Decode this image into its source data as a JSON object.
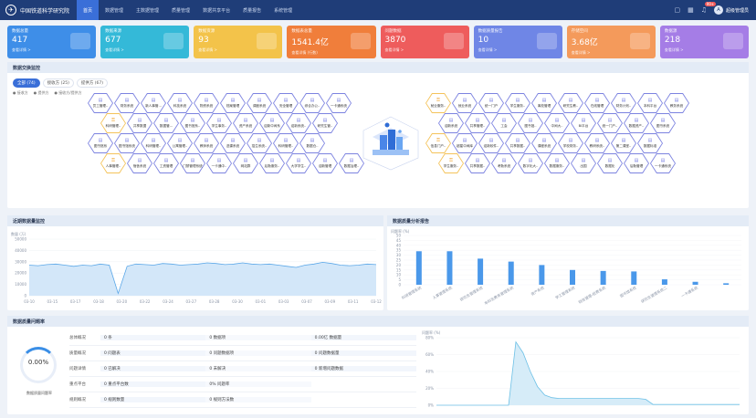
{
  "app": {
    "title": "中国铁道科学研究院",
    "nav": [
      "首页",
      "数据管理",
      "主数据管理",
      "质量管理",
      "数据共享平台",
      "质量报告",
      "系统管理"
    ],
    "active_nav": 0,
    "right_icons": [
      "monitor-icon",
      "grid-icon",
      "bell-icon"
    ],
    "notification_count": "99+",
    "user": "超级管理员"
  },
  "cards": [
    {
      "title": "数据总量",
      "value": "417",
      "link": "查看详情 >",
      "color": "#3e8ee8"
    },
    {
      "title": "数据来源",
      "value": "677",
      "link": "查看详情 >",
      "color": "#34b9d8"
    },
    {
      "title": "数据资源",
      "value": "93",
      "link": "查看详情 >",
      "color": "#f3c34a"
    },
    {
      "title": "数据表总量",
      "value": "1541.4亿",
      "link": "查看详情 (行数)",
      "color": "#f07e3b"
    },
    {
      "title": "问题数据",
      "value": "3870",
      "link": "查看详情 >",
      "color": "#ee5c5c"
    },
    {
      "title": "数据质量报告",
      "value": "10",
      "link": "查看详情 >",
      "color": "#6f86e6"
    },
    {
      "title": "存储空间",
      "value": "3.68亿",
      "link": "查看详情 >",
      "color": "#f49a5b"
    },
    {
      "title": "数据源",
      "value": "218",
      "link": "查看详情 >",
      "color": "#a57de6"
    }
  ],
  "topology": {
    "title": "数据交换监控",
    "filters": [
      {
        "label": "全部 (74)"
      },
      {
        "label": "接收方 (25)"
      },
      {
        "label": "提供方 (67)"
      }
    ],
    "legend": [
      "● 接收方",
      "● 提供方",
      "● 接收方/提供方"
    ],
    "left_hexes": [
      {
        "n": "员工管理..",
        "s": "on"
      },
      {
        "n": "财务系统",
        "s": "on"
      },
      {
        "n": "新人事管...",
        "s": "on"
      },
      {
        "n": "科技系统",
        "s": "on"
      },
      {
        "n": "物资系统",
        "s": "on"
      },
      {
        "n": "档案管理",
        "s": "on"
      },
      {
        "n": "调度系统",
        "s": "on"
      },
      {
        "n": "安全管理",
        "s": "on"
      },
      {
        "n": "综合办公..",
        "s": "on"
      },
      {
        "n": "一卡通系统",
        "s": "on"
      },
      {
        "n": "科研管理..",
        "s": "warn"
      },
      {
        "n": "共享数据",
        "s": "on"
      },
      {
        "n": "数据管...",
        "s": "on"
      },
      {
        "n": "图书馆系..",
        "s": "on"
      },
      {
        "n": "学生事务..",
        "s": "on"
      },
      {
        "n": "资产系统",
        "s": "on"
      },
      {
        "n": "迎新中间系",
        "s": "on"
      },
      {
        "n": "迎新系统..",
        "s": "on"
      },
      {
        "n": "研究生管..",
        "s": "on"
      },
      {
        "n": "图书馆系",
        "s": "on"
      },
      {
        "n": "图书馆系统",
        "s": "on"
      },
      {
        "n": "科研管理..",
        "s": "on"
      },
      {
        "n": "公寓管理..",
        "s": "on"
      },
      {
        "n": "教师系统",
        "s": "on"
      },
      {
        "n": "选课系统",
        "s": "on"
      },
      {
        "n": "招生系统..",
        "s": "on"
      },
      {
        "n": "科研管理..",
        "s": "on"
      },
      {
        "n": "数据仓..",
        "s": "on"
      },
      {
        "n": "人事管理..",
        "s": "warn"
      },
      {
        "n": "宿舍系统",
        "s": "on"
      },
      {
        "n": "工资管理",
        "s": "on"
      },
      {
        "n": "门禁管理系统",
        "s": "on"
      },
      {
        "n": "一卡通中..",
        "s": "on"
      },
      {
        "n": "网站群",
        "s": "on"
      },
      {
        "n": "后勤服务..",
        "s": "on"
      },
      {
        "n": "大学学生..",
        "s": "on"
      },
      {
        "n": "迎新管理",
        "s": "on"
      },
      {
        "n": "数据治理..",
        "s": "on"
      }
    ],
    "right_hexes": [
      {
        "n": "就业服务..",
        "s": "warn"
      },
      {
        "n": "就业系统",
        "s": "on"
      },
      {
        "n": "统一门户",
        "s": "on"
      },
      {
        "n": "学生服务..",
        "s": "on"
      },
      {
        "n": "离校管理",
        "s": "on"
      },
      {
        "n": "研究生教..",
        "s": "on"
      },
      {
        "n": "在线管理",
        "s": "on"
      },
      {
        "n": "财务计划..",
        "s": "on"
      },
      {
        "n": "本科平台",
        "s": "on"
      },
      {
        "n": "教务系统",
        "s": "on"
      },
      {
        "n": "迎新系统",
        "s": "on"
      },
      {
        "n": "共享管理..",
        "s": "on"
      },
      {
        "n": "工会",
        "s": "on"
      },
      {
        "n": "图书馆..",
        "s": "on"
      },
      {
        "n": "中间大..",
        "s": "on"
      },
      {
        "n": "BI平台",
        "s": "on"
      },
      {
        "n": "统一门户..",
        "s": "on"
      },
      {
        "n": "数据资产..",
        "s": "on"
      },
      {
        "n": "图书系统",
        "s": "on"
      },
      {
        "n": "信息门户..",
        "s": "warn"
      },
      {
        "n": "超星中间库",
        "s": "on"
      },
      {
        "n": "迎新软件..",
        "s": "on"
      },
      {
        "n": "共享数据..",
        "s": "on"
      },
      {
        "n": "课程系统",
        "s": "on"
      },
      {
        "n": "学校财务..",
        "s": "on"
      },
      {
        "n": "教研系统..",
        "s": "on"
      },
      {
        "n": "第二课堂..",
        "s": "on"
      },
      {
        "n": "数据标准",
        "s": "on"
      },
      {
        "n": "学生服务..",
        "s": "warn"
      },
      {
        "n": "共享数据..",
        "s": "on"
      },
      {
        "n": "考勤系统",
        "s": "on"
      },
      {
        "n": "数字化大..",
        "s": "on"
      },
      {
        "n": "数据服务..",
        "s": "on"
      },
      {
        "n": "出国",
        "s": "on"
      },
      {
        "n": "数据化",
        "s": "on"
      },
      {
        "n": "后勤管理",
        "s": "on"
      },
      {
        "n": "一卡通系统",
        "s": "on"
      }
    ]
  },
  "line_panel": {
    "title": "近期数据量监控",
    "chart_data": {
      "type": "area",
      "ylabel": "数量 (万)",
      "yticks": [
        "50000",
        "40000",
        "30000",
        "20000",
        "10000",
        "0"
      ],
      "ylim": [
        0,
        50000
      ],
      "x": [
        "03-10",
        "03-15",
        "03-17",
        "03-18",
        "03-20",
        "03-22",
        "03-24",
        "03-27",
        "03-28",
        "03-30",
        "03-01",
        "03-03",
        "03-07",
        "03-09",
        "03-11",
        "03-12"
      ],
      "values": [
        27000,
        26500,
        27500,
        28000,
        27000,
        26000,
        27000,
        26500,
        28000,
        27000,
        2000,
        26000,
        28000,
        27500,
        27000,
        28500,
        28000,
        27000,
        27500,
        28000,
        29000,
        28500,
        27500,
        28000,
        29000,
        28000,
        27500,
        28000,
        27000,
        26000,
        25000,
        27000,
        28000,
        29500,
        28500,
        27000,
        26500,
        27000,
        28000,
        27500
      ]
    }
  },
  "bar_panel": {
    "title": "数据质量分析报告",
    "chart_data": {
      "type": "bar",
      "ylabel": "问题率 (%)",
      "yticks": [
        "50",
        "45",
        "40",
        "35",
        "30",
        "25",
        "20",
        "15",
        "10",
        "5",
        "0"
      ],
      "ylim": [
        0,
        50
      ],
      "categories": [
        "科研管理系统",
        "人事管理系统",
        "研究生管理系统",
        "本科生教务管理系统",
        "资产系统",
        "学工管理系统",
        "财务管理-经费系统",
        "图书馆系统",
        "研究生管理系统二",
        "一卡通系统"
      ],
      "values": [
        34,
        34,
        26.5,
        23.5,
        20,
        15,
        14,
        13.5,
        5.5,
        3,
        1.5
      ]
    }
  },
  "quality_panel": {
    "title": "数据质量问题率",
    "rate": "0.00%",
    "rate_caption": "数据质量问题率",
    "rows": [
      {
        "h": "总体概况",
        "c1": "0 条",
        "c2": "0 数据项",
        "c3": "0.00亿 数据量"
      },
      {
        "h": "质量概况",
        "c1": "0 问题表",
        "c2": "0 问题数据项",
        "c3": "0 问题数据量"
      },
      {
        "h": "问题详情",
        "c1": "0 已解决",
        "c2": "0 未解决",
        "c3": "0 新增问题数据"
      },
      {
        "h": "重点平台",
        "c1": "0 重点平台数",
        "c2": "0% 问题率",
        "c3": ""
      },
      {
        "h": "规则概况",
        "c1": "0 规则数量",
        "c2": "0 规则方法数",
        "c3": ""
      }
    ],
    "chart_data": {
      "type": "area",
      "ylabel": "问题率 (%)",
      "yticks": [
        "80%",
        "60%",
        "40%",
        "20%",
        "0%"
      ],
      "ylim": [
        0,
        80
      ],
      "values": [
        0,
        0,
        0,
        0,
        0,
        0,
        0,
        0,
        0,
        0,
        0,
        75,
        62,
        40,
        22,
        12,
        9,
        8,
        8,
        8,
        8,
        8,
        8,
        8,
        8,
        8,
        8,
        8,
        8,
        7,
        1,
        1,
        1,
        1,
        1,
        1,
        1,
        1,
        1,
        1,
        1,
        1,
        1
      ]
    }
  }
}
